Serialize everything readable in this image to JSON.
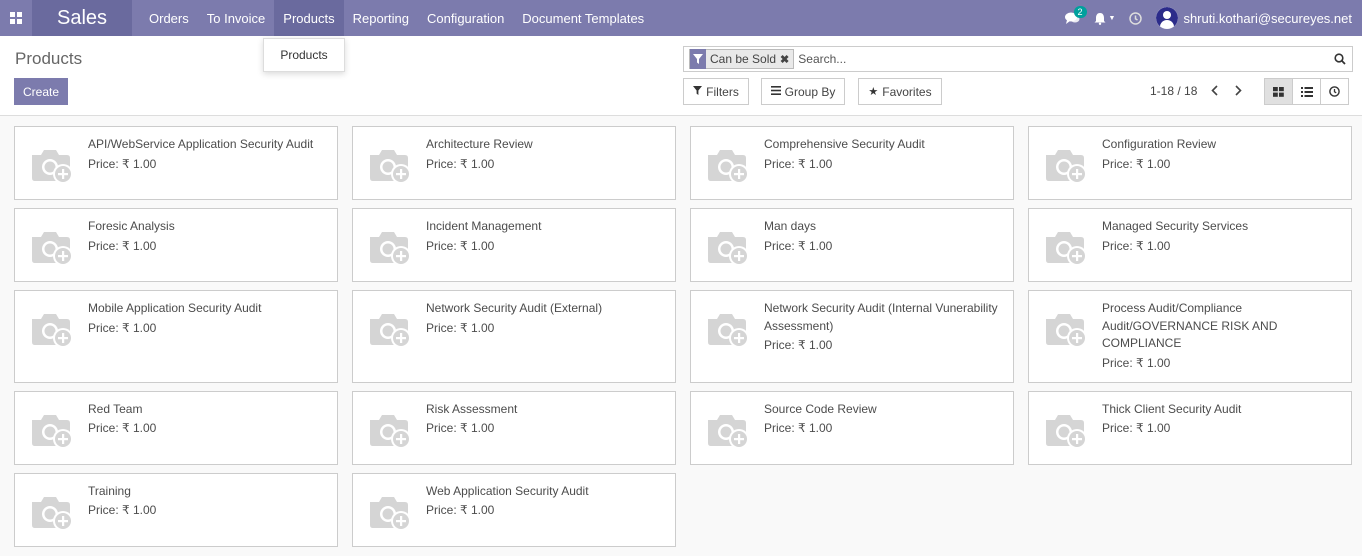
{
  "navbar": {
    "brand": "Sales",
    "menu": [
      "Orders",
      "To Invoice",
      "Products",
      "Reporting",
      "Configuration",
      "Document Templates"
    ],
    "active_menu": "Products",
    "message_count": "2",
    "user_email": "shruti.kothari@secureyes.net"
  },
  "dropdown": {
    "items": [
      "Products"
    ]
  },
  "control_panel": {
    "title": "Products",
    "create_label": "Create",
    "facet_label": "Can be Sold",
    "search_placeholder": "Search...",
    "filters_label": "Filters",
    "group_by_label": "Group By",
    "favorites_label": "Favorites",
    "pager": "1-18 / 18"
  },
  "products": [
    {
      "name": "API/WebService Application Security Audit",
      "price": "Price: ₹ 1.00"
    },
    {
      "name": "Architecture Review",
      "price": "Price: ₹ 1.00"
    },
    {
      "name": "Comprehensive Security Audit",
      "price": "Price: ₹ 1.00"
    },
    {
      "name": "Configuration Review",
      "price": "Price: ₹ 1.00"
    },
    {
      "name": "Foresic Analysis",
      "price": "Price: ₹ 1.00"
    },
    {
      "name": "Incident Management",
      "price": "Price: ₹ 1.00"
    },
    {
      "name": "Man days",
      "price": "Price: ₹ 1.00"
    },
    {
      "name": "Managed Security Services",
      "price": "Price: ₹ 1.00"
    },
    {
      "name": "Mobile Application Security Audit",
      "price": "Price: ₹ 1.00"
    },
    {
      "name": "Network Security Audit (External)",
      "price": "Price: ₹ 1.00"
    },
    {
      "name": "Network Security Audit (Internal Vunerability Assessment)",
      "price": "Price: ₹ 1.00"
    },
    {
      "name": "Process Audit/Compliance Audit/GOVERNANCE RISK AND COMPLIANCE",
      "price": "Price: ₹ 1.00"
    },
    {
      "name": "Red Team",
      "price": "Price: ₹ 1.00"
    },
    {
      "name": "Risk Assessment",
      "price": "Price: ₹ 1.00"
    },
    {
      "name": "Source Code Review",
      "price": "Price: ₹ 1.00"
    },
    {
      "name": "Thick Client Security Audit",
      "price": "Price: ₹ 1.00"
    },
    {
      "name": "Training",
      "price": "Price: ₹ 1.00"
    },
    {
      "name": "Web Application Security Audit",
      "price": "Price: ₹ 1.00"
    }
  ],
  "colors": {
    "primary": "#7c7bad",
    "primary_dark": "#6a6a9e",
    "badge": "#00a09d"
  }
}
